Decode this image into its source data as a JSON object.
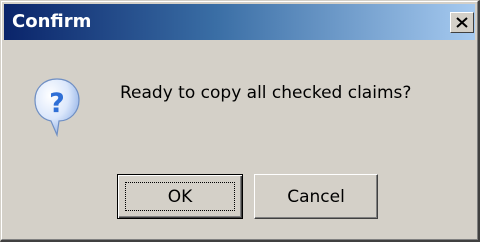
{
  "window": {
    "title": "Confirm",
    "close_icon": "close-icon"
  },
  "message": {
    "icon": "question-icon",
    "text": "Ready to copy all checked claims?"
  },
  "buttons": {
    "ok_label": "OK",
    "cancel_label": "Cancel"
  },
  "colors": {
    "dialog_face": "#d4d0c8",
    "title_gradient_start": "#0a246a",
    "title_gradient_end": "#a6caf0",
    "title_text": "#ffffff",
    "icon_blue": "#2f6fd6"
  }
}
